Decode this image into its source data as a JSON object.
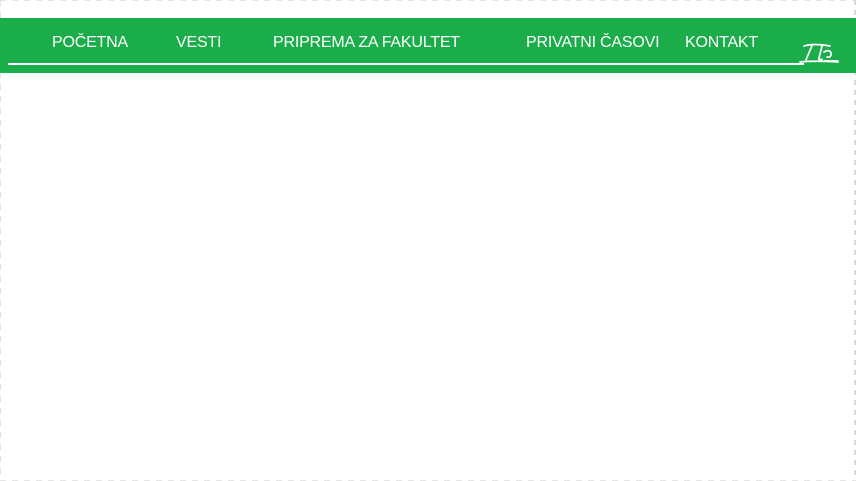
{
  "navbar": {
    "background": "#1aad4a",
    "text_color": "#ffffff",
    "items": [
      {
        "label": "POČETNA"
      },
      {
        "label": "VESTI"
      },
      {
        "label": "PRIPREMA ZA FAKULTET"
      },
      {
        "label": "PRIVATNI ČASOVI"
      },
      {
        "label": "KONTAKT"
      }
    ],
    "logo_icon": "pi-logo-icon"
  }
}
